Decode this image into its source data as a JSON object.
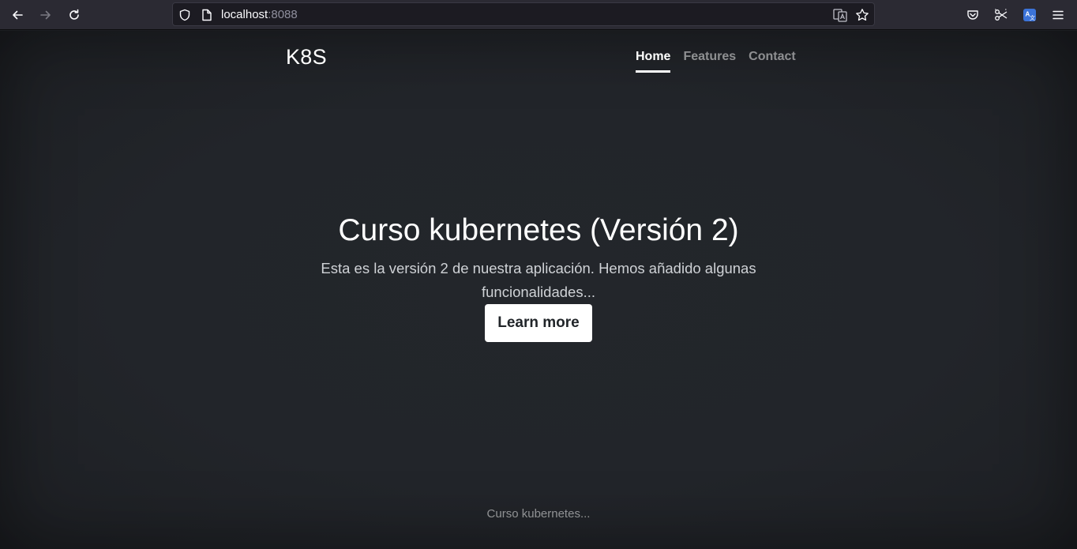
{
  "browser": {
    "url_host": "localhost",
    "url_port": ":8088",
    "icons": {
      "back": "back-arrow-icon",
      "forward": "forward-arrow-icon",
      "reload": "reload-icon",
      "tracking": "shield-icon",
      "page": "page-icon",
      "translate": "translate-icon",
      "bookmark": "star-icon",
      "pocket": "pocket-icon",
      "screenshot": "scissors-icon",
      "extension": "translate-extension-icon",
      "menu": "hamburger-menu-icon"
    }
  },
  "site": {
    "brand": "K8S",
    "nav": [
      {
        "label": "Home",
        "active": true
      },
      {
        "label": "Features",
        "active": false
      },
      {
        "label": "Contact",
        "active": false
      }
    ]
  },
  "hero": {
    "title": "Curso kubernetes (Versión 2)",
    "lead": "Esta es la versión 2 de nuestra aplicación. Hemos añadido algunas funcionalidades...",
    "button_label": "Learn more"
  },
  "footer": {
    "text": "Curso kubernetes..."
  },
  "colors": {
    "page_background": "#22252a",
    "text_primary": "#ffffff",
    "text_muted": "#8e9196",
    "button_background": "#ffffff",
    "browser_chrome": "#2b2a33"
  }
}
